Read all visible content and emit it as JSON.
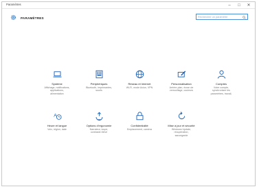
{
  "window": {
    "title": "Paramètres",
    "minimize": "–",
    "maximize": "□",
    "close": "✕"
  },
  "header": {
    "app_title": "PARAMÈTRES",
    "search_placeholder": "Rechercher un paramètre"
  },
  "accent_color": "#1a5fb4",
  "tiles": [
    {
      "title": "Système",
      "desc": [
        "Affichage, notifications,",
        "applications,",
        "alimentation"
      ],
      "icon": "laptop-icon"
    },
    {
      "title": "Périphériques",
      "desc": [
        "Bluetooth, imprimantes,",
        "souris"
      ],
      "icon": "keyboard-icon"
    },
    {
      "title": "Réseau et Internet",
      "desc": [
        "Wi-Fi, mode Avion, VPN"
      ],
      "icon": "globe-icon"
    },
    {
      "title": "Personnalisation",
      "desc": [
        "Arrière-plan, écran de",
        "verrouillage, couleurs"
      ],
      "icon": "paintbrush-icon"
    },
    {
      "title": "Comptes",
      "desc": [
        "Votre compte,",
        "synchroniser les",
        "paramètres, travail,"
      ],
      "icon": "person-icon"
    },
    {
      "title": "Heure et langue",
      "desc": [
        "Voix, région, date"
      ],
      "icon": "time-language-icon"
    },
    {
      "title": "Options d'ergonomie",
      "desc": [
        "Narrateur, loupe,",
        "contraste élevé"
      ],
      "icon": "ease-of-access-icon"
    },
    {
      "title": "Confidentialité",
      "desc": [
        "Emplacement, caméra"
      ],
      "icon": "lock-icon"
    },
    {
      "title": "Mise à jour et sécurité",
      "desc": [
        "Windows Update,",
        "récupération,",
        "sauvegarde"
      ],
      "icon": "update-icon"
    }
  ]
}
